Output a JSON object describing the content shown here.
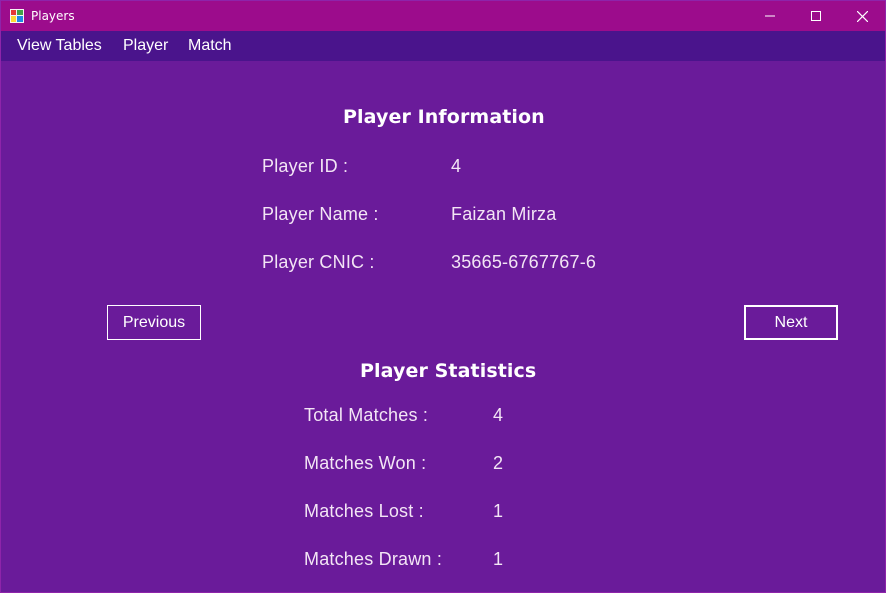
{
  "window": {
    "title": "Players",
    "controls": {
      "minimize_icon": "minimize-icon",
      "maximize_icon": "maximize-icon",
      "close_icon": "close-icon"
    }
  },
  "menu": {
    "items": [
      {
        "label": "View Tables"
      },
      {
        "label": "Player"
      },
      {
        "label": "Match"
      }
    ]
  },
  "player_info": {
    "heading": "Player Information",
    "id_label": "Player ID :",
    "id_value": "4",
    "name_label": "Player Name :",
    "name_value": "Faizan Mirza",
    "cnic_label": "Player CNIC :",
    "cnic_value": "35665-6767767-6"
  },
  "nav": {
    "previous_label": "Previous",
    "next_label": "Next"
  },
  "stats": {
    "heading": "Player Statistics",
    "total_label": "Total Matches :",
    "total_value": "4",
    "won_label": "Matches Won :",
    "won_value": "2",
    "lost_label": "Matches Lost :",
    "lost_value": "1",
    "drawn_label": "Matches Drawn :",
    "drawn_value": "1"
  },
  "colors": {
    "titlebar": "#9c0c8c",
    "menubar": "#4a148c",
    "background": "#6a1b9a",
    "text": "#ffffff"
  }
}
